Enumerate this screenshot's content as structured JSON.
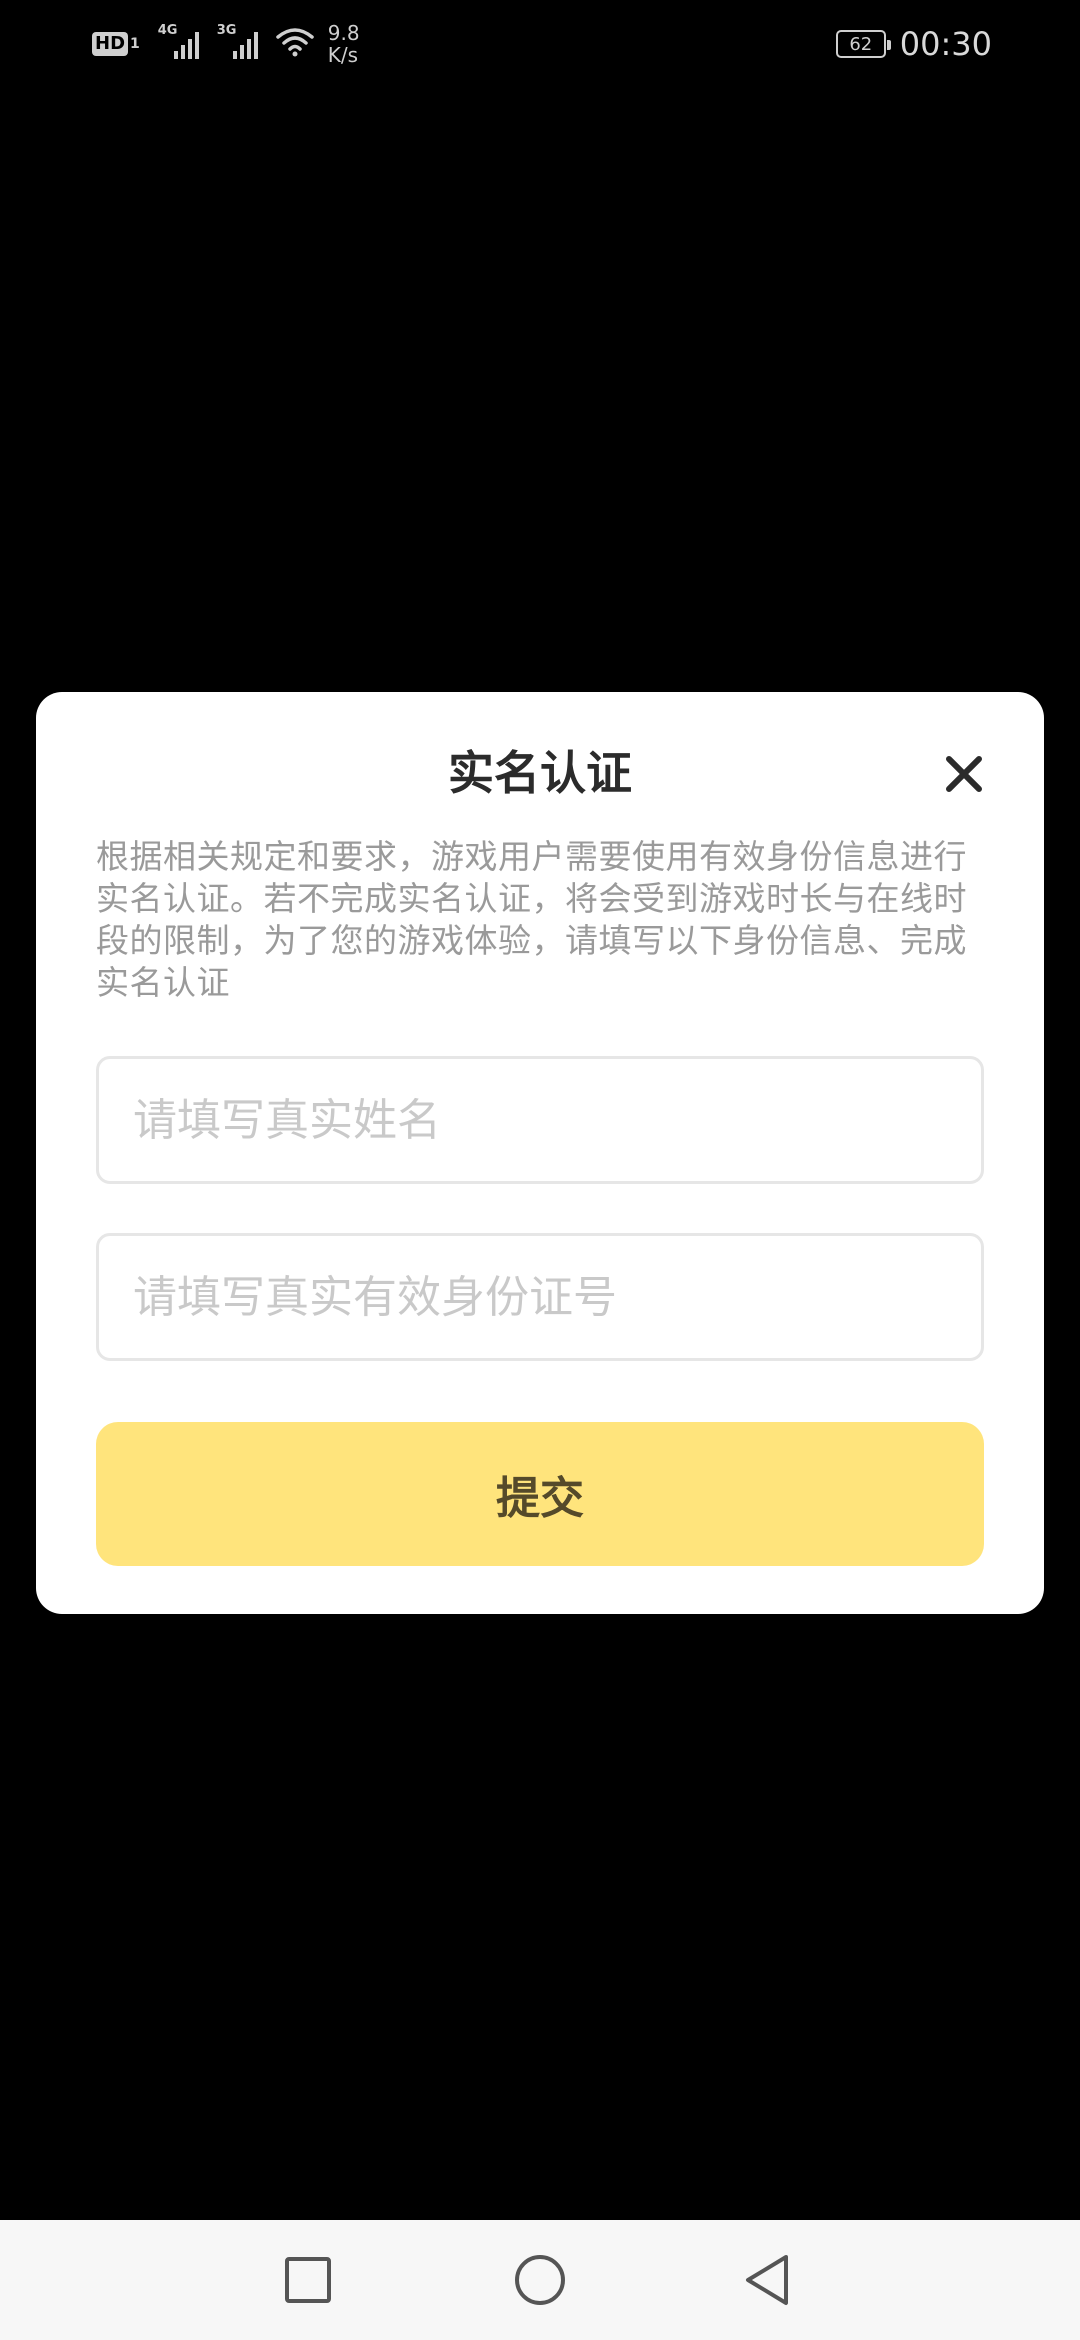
{
  "status_bar": {
    "hd_label": "HD",
    "hd_sub": "1",
    "network_1": "4G",
    "network_2": "3G",
    "speed_value": "9.8",
    "speed_unit": "K/s",
    "battery": "62",
    "time": "00:30"
  },
  "dialog": {
    "title": "实名认证",
    "notice": "根据相关规定和要求，游戏用户需要使用有效身份信息进行实名认证。若不完成实名认证，将会受到游戏时长与在线时段的限制，为了您的游戏体验，请填写以下身份信息、完成实名认证",
    "name_placeholder": "请填写真实姓名",
    "name_value": "",
    "id_placeholder": "请填写真实有效身份证号",
    "id_value": "",
    "submit_label": "提交"
  },
  "icons": {
    "close": "close-icon",
    "recent": "square-icon",
    "home": "circle-icon",
    "back": "triangle-back-icon"
  },
  "colors": {
    "overlay": "#000000",
    "dialog_bg": "#ffffff",
    "submit_bg": "#ffe47c",
    "submit_text": "#554a2a",
    "notice_text": "#9a9a9a"
  }
}
